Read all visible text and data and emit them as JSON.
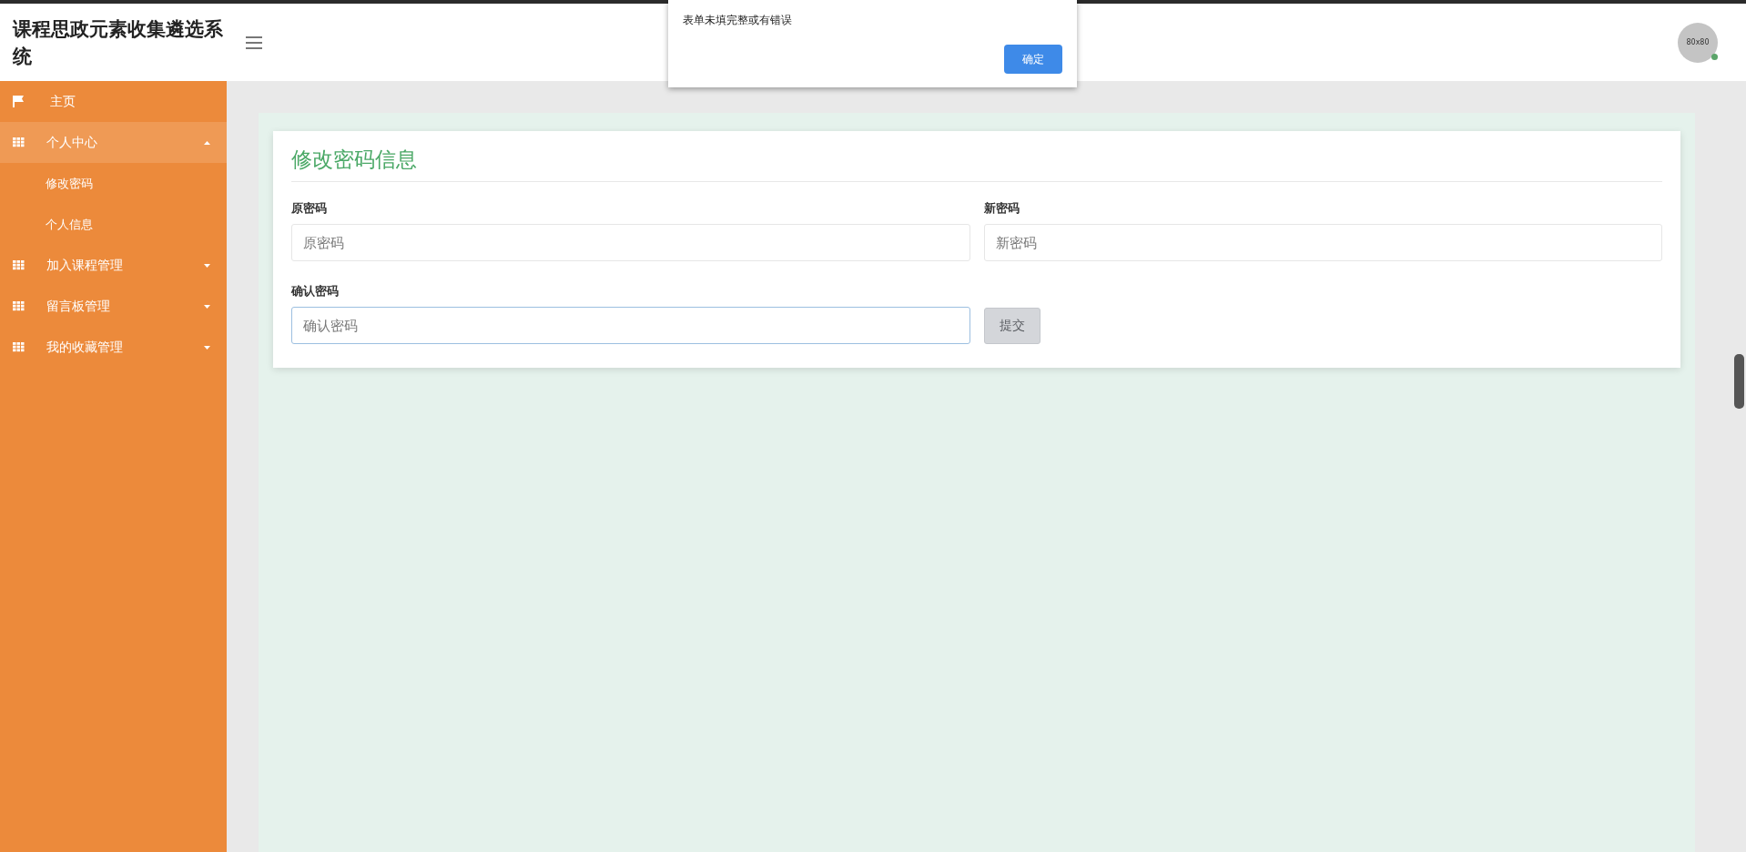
{
  "header": {
    "title": "课程思政元素收集遴选系统",
    "avatar": {
      "label": "80x80",
      "online": true
    }
  },
  "sidebar": {
    "items": [
      {
        "kind": "home",
        "label": "主页"
      },
      {
        "kind": "group",
        "label": "个人中心",
        "expanded": true,
        "children": [
          {
            "label": "修改密码"
          },
          {
            "label": "个人信息"
          }
        ]
      },
      {
        "kind": "group",
        "label": "加入课程管理",
        "expanded": false
      },
      {
        "kind": "group",
        "label": "留言板管理",
        "expanded": false
      },
      {
        "kind": "group",
        "label": "我的收藏管理",
        "expanded": false
      }
    ]
  },
  "form": {
    "title": "修改密码信息",
    "fields": [
      {
        "label": "原密码",
        "placeholder": "原密码",
        "focused": false
      },
      {
        "label": "新密码",
        "placeholder": "新密码",
        "focused": false
      },
      {
        "label": "确认密码",
        "placeholder": "确认密码",
        "focused": true
      }
    ],
    "submit": {
      "label": "提交",
      "disabled": true
    }
  },
  "dialog": {
    "message": "表单未填完整或有错误",
    "button": "确定"
  }
}
